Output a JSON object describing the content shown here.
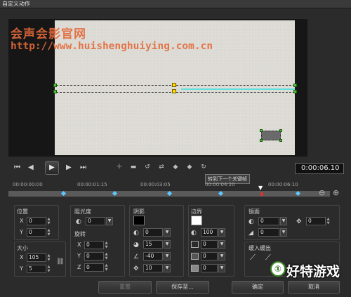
{
  "window": {
    "title": "自定义动作"
  },
  "watermark": {
    "line1": "会声会影官网",
    "line2": "http://www.huishenghuiying.com.cn"
  },
  "playback": {
    "buttons": [
      "home-icon",
      "prev-frame-icon",
      "play-icon",
      "next-frame-icon",
      "end-icon"
    ],
    "timecode": "0:00:06.10"
  },
  "keyframe_tools": {
    "icons": [
      "add-keyframe-icon",
      "delete-keyframe-icon",
      "reverse-keyframe-icon",
      "move-keyframe-icon",
      "prev-keyframe-icon",
      "next-keyframe-icon",
      "go-next-keyframe-icon"
    ],
    "tooltip": "转到下一个关键帧"
  },
  "timeline": {
    "ticks": [
      "00:00:00:00",
      "00:00:01:15",
      "00:00:03:05",
      "00:00:04:20",
      "00:00:06:10"
    ],
    "keyframes": [
      0.17,
      0.33,
      0.5,
      0.66,
      0.9
    ],
    "current": "00:00:06:10"
  },
  "position": {
    "label": "位置",
    "x_axis": "X",
    "x": "0",
    "y_axis": "Y",
    "y": "0"
  },
  "size": {
    "label": "大小",
    "x_axis": "X",
    "x": "105",
    "y_axis": "Y",
    "y": "5"
  },
  "opacity": {
    "label": "阻光度",
    "value": "0"
  },
  "rotation": {
    "label": "旋转",
    "x_axis": "X",
    "x": "0",
    "y_axis": "Y",
    "y": "0",
    "z_axis": "Z",
    "z": "0"
  },
  "shadow": {
    "label": "阴影",
    "color": "#000000",
    "opacity": "0",
    "blur": "15",
    "angle": "-40",
    "distance": "10"
  },
  "border": {
    "label": "边界",
    "color": "#ffffff",
    "transparency": "100",
    "v1": "0",
    "v2": "0",
    "v3": "0",
    "v4": "0"
  },
  "mirror": {
    "label": "镜面",
    "v1": "0",
    "v2": "0",
    "v3": "0"
  },
  "ease": {
    "label": "缓入缓出"
  },
  "buttons": {
    "reset": "重置",
    "save_as": "保存至...",
    "ok": "确定",
    "cancel": "取消"
  },
  "logo": {
    "badge": "①",
    "text": "好特游戏"
  }
}
